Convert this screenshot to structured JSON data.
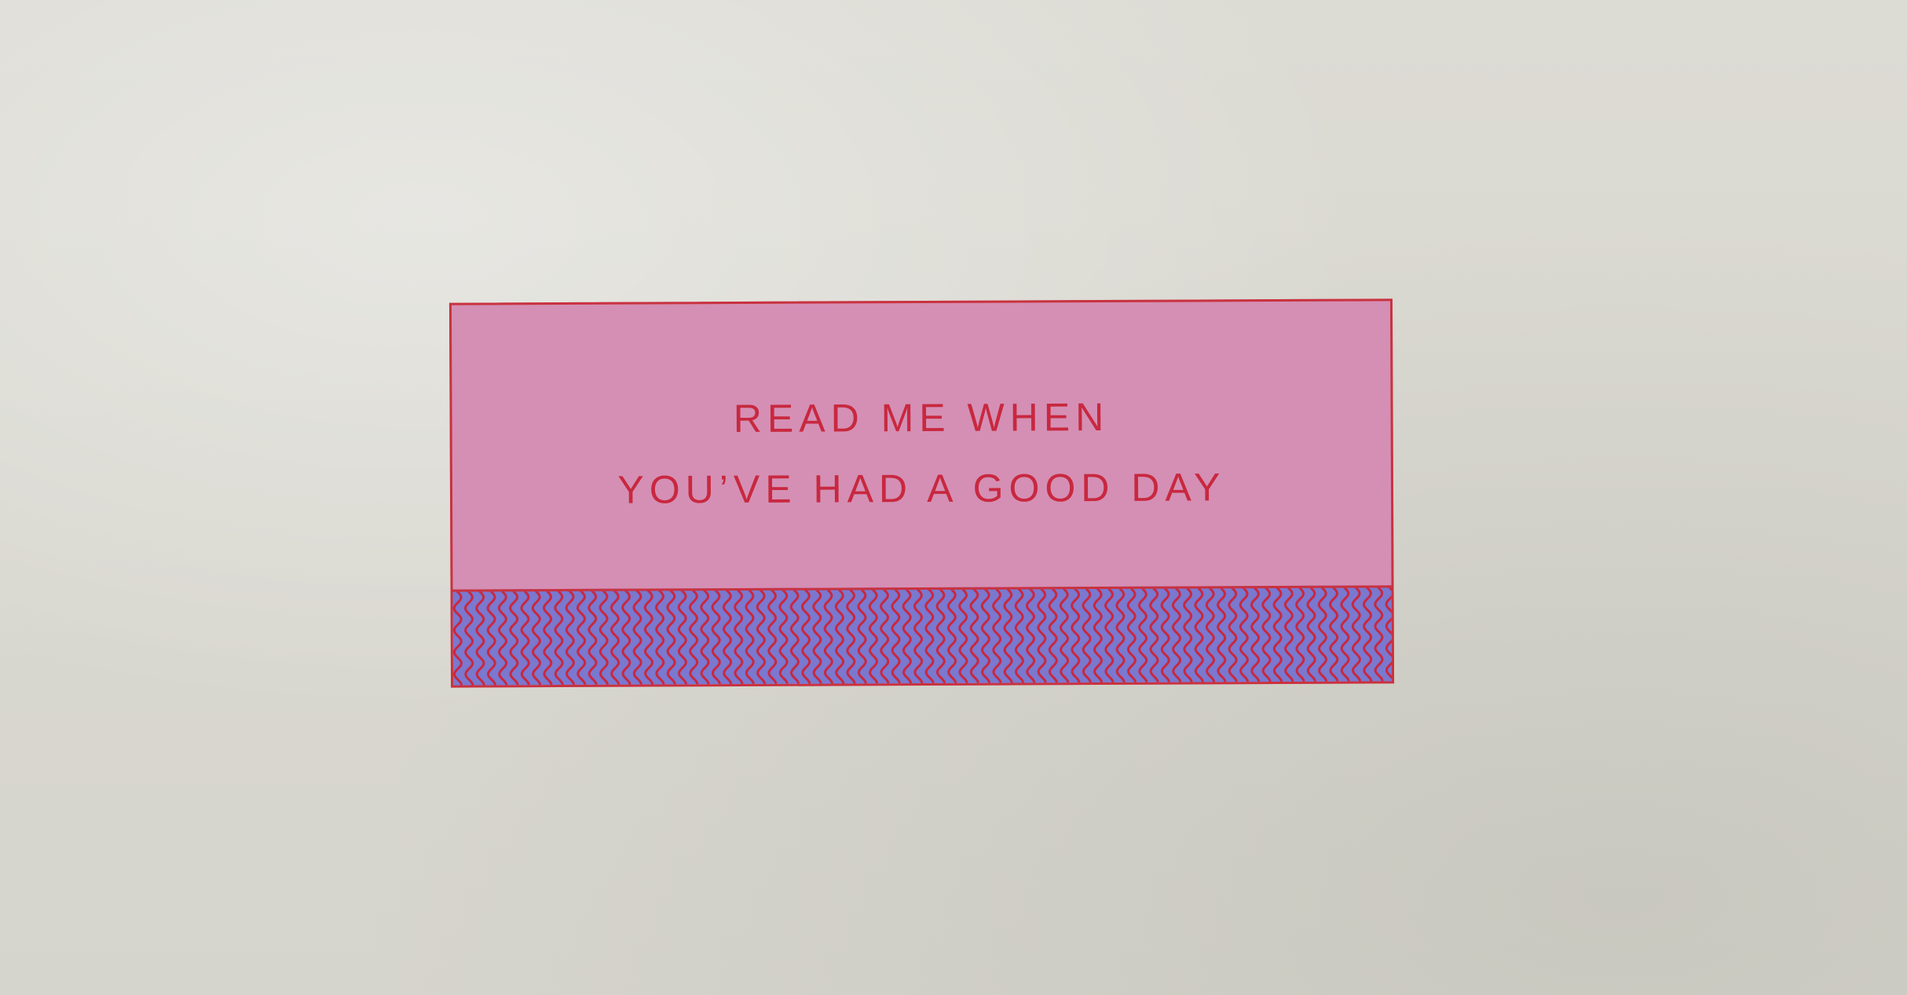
{
  "card": {
    "line1": "READ ME WHEN",
    "line2": "YOU’VE HAD A GOOD DAY"
  },
  "colors": {
    "background": "#d9d8d0",
    "card_fill": "#d58fb4",
    "ink_red": "#c8283f",
    "band_blue": "#7a78cf"
  }
}
